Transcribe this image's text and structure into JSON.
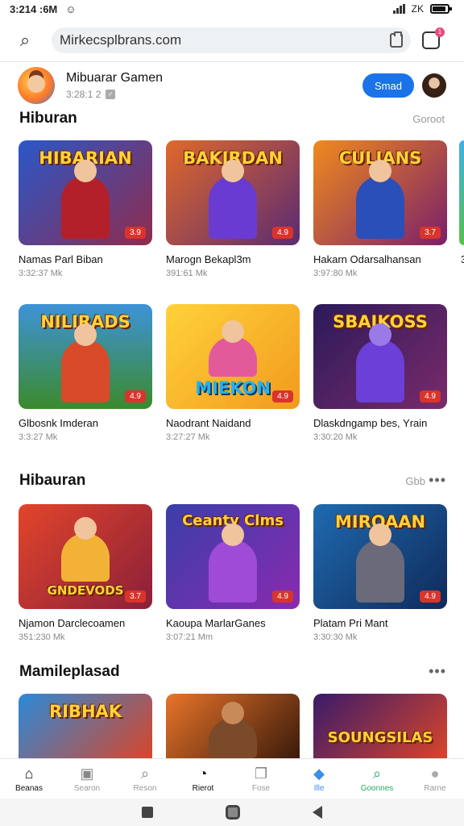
{
  "status_bar": {
    "time": "3:214 :6M",
    "right_text": "ZK"
  },
  "browser": {
    "url": "Mirkecsplbrans.com",
    "tab_count": "1"
  },
  "site": {
    "name": "Mibuarar Gamen",
    "subtitle": "3:28:1 2",
    "action_label": "Smad"
  },
  "sections": [
    {
      "title": "Hiburan",
      "link": "Goroot",
      "rows": [
        [
          {
            "thumb_title": "HIBARIAN",
            "badge": "3.9",
            "name": "Namas Parl Biban",
            "meta": "3:32:37 Mk",
            "colors": [
              "#2a57c9",
              "#8f2b4c"
            ],
            "hero": "#b3202a"
          },
          {
            "thumb_title": "BAKIRDAN",
            "badge": "4.9",
            "name": "Marogn Bekapl3m",
            "meta": "391:61 Mk",
            "colors": [
              "#e0692a",
              "#5b2a73"
            ],
            "hero": "#6a3bd0"
          },
          {
            "thumb_title": "CULIANS",
            "badge": "3.7",
            "name": "Hakarn Odarsalhansan",
            "meta": "3:97:80 Mk",
            "colors": [
              "#f08a1e",
              "#7a1f6a"
            ],
            "hero": "#2b4fb8"
          }
        ],
        [
          {
            "thumb_title": "NILIRADS",
            "badge": "4.9",
            "name": "Glbosnk Imderan",
            "meta": "3:3:27 Mk",
            "colors": [
              "#3d93d8",
              "#3c8a2c"
            ],
            "hero": "#d94a2a"
          },
          {
            "thumb_title": "MIEKON",
            "badge": "4.9",
            "name": "Naodrant Naidand",
            "meta": "3:27:27 Mk",
            "colors": [
              "#ffd23a",
              "#f29a1e"
            ],
            "hero": "#e35a9a"
          },
          {
            "thumb_title": "SBAIKOSS",
            "badge": "4.9",
            "name": "Dlaskdngamp bes, Yrain",
            "meta": "3:30:20 Mk",
            "colors": [
              "#2b1a5a",
              "#7a2a6a"
            ],
            "hero": "#6b3fd8"
          }
        ]
      ],
      "edge_name": "3"
    },
    {
      "title": "Hibauran",
      "link": "Gbb",
      "rows": [
        [
          {
            "thumb_title": "GNDEVODS",
            "badge": "3.7",
            "name": "Njamon Darclecoamen",
            "meta": "351:230 Mk",
            "colors": [
              "#e2452a",
              "#8a1f3a"
            ],
            "hero": "#f2b236"
          },
          {
            "thumb_title": "Ceanty Clms",
            "badge": "4.9",
            "name": "Kaoupa MarlarGanes",
            "meta": "3:07:21 Mm",
            "colors": [
              "#3a3fa8",
              "#8a2ab0"
            ],
            "hero": "#a04ad8"
          },
          {
            "thumb_title": "MIROAAN",
            "badge": "4.9",
            "name": "Platam Pri Mant",
            "meta": "3:30:30 Mk",
            "colors": [
              "#1f6ab0",
              "#0f2a5a"
            ],
            "hero": "#6a6a7a"
          }
        ]
      ]
    },
    {
      "title": "Mamileplasad",
      "rows": [
        [
          {
            "thumb_title": "RIBHAK",
            "badge": "",
            "name": "",
            "meta": "",
            "colors": [
              "#2a8ad8",
              "#d8462a"
            ],
            "hero": "#ff7a2a"
          },
          {
            "thumb_title": "",
            "badge": "",
            "name": "",
            "meta": "",
            "colors": [
              "#e8742a",
              "#3a1a0a"
            ],
            "hero": "#7a4a2a"
          },
          {
            "thumb_title": "SOUNGSILAS",
            "badge": "",
            "name": "",
            "meta": "",
            "colors": [
              "#3a1a6a",
              "#d8452a"
            ],
            "hero": "#5a3aa8"
          }
        ]
      ]
    }
  ],
  "bottom_nav": [
    {
      "label": "Beanas",
      "icon": "home-icon",
      "glyph": "⌂",
      "active": true
    },
    {
      "label": "Searon",
      "icon": "image-icon",
      "glyph": "▣",
      "active": false
    },
    {
      "label": "Reson",
      "icon": "search-icon",
      "glyph": "⌕",
      "active": false
    },
    {
      "label": "Rierot",
      "icon": "compass-icon",
      "glyph": "◔",
      "active": true
    },
    {
      "label": "Fose",
      "icon": "book-icon",
      "glyph": "❐",
      "active": false
    },
    {
      "label": "Ille",
      "icon": "shield-icon",
      "glyph": "◆",
      "active": false,
      "color": "#3a8ee8"
    },
    {
      "label": "Goonnes",
      "icon": "games-search-icon",
      "glyph": "⌕",
      "active": false,
      "color": "#2aa86a"
    },
    {
      "label": "Rarne",
      "icon": "person-icon",
      "glyph": "●",
      "active": false
    }
  ]
}
